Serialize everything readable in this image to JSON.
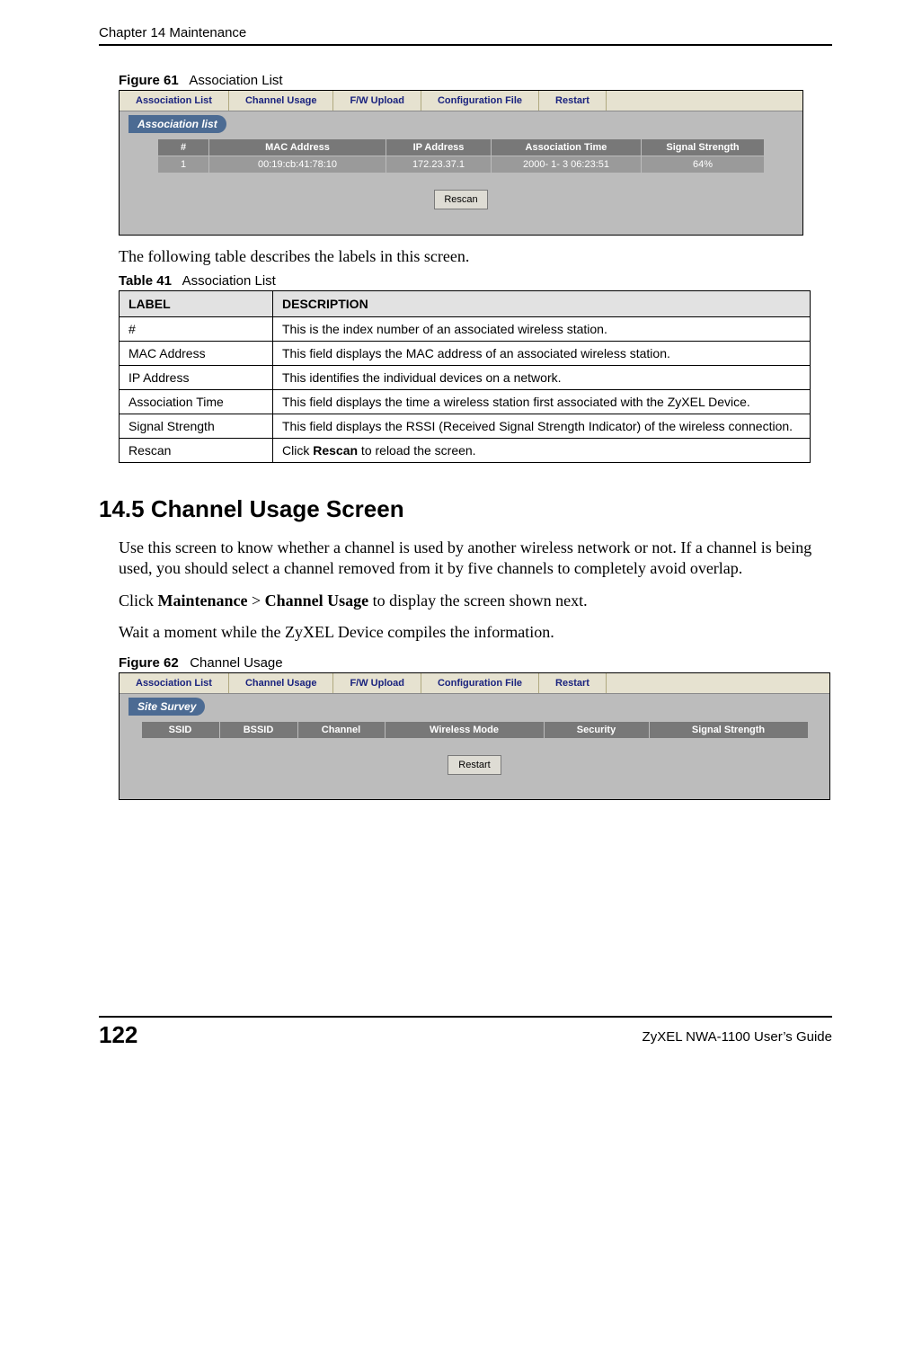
{
  "header": {
    "left": "Chapter 14 Maintenance"
  },
  "figure61": {
    "caption_bold": "Figure 61",
    "caption_rest": "Association List",
    "tabs": [
      "Association List",
      "Channel Usage",
      "F/W Upload",
      "Configuration File",
      "Restart"
    ],
    "bar": "Association list",
    "headers": [
      "#",
      "MAC Address",
      "IP Address",
      "Association Time",
      "Signal Strength"
    ],
    "row": [
      "1",
      "00:19:cb:41:78:10",
      "172.23.37.1",
      "2000- 1- 3 06:23:51",
      "64%"
    ],
    "button": "Rescan"
  },
  "intro_line": "The following table describes the labels in this screen.",
  "table41": {
    "caption_bold": "Table 41",
    "caption_rest": "Association List",
    "headers": [
      "LABEL",
      "DESCRIPTION"
    ],
    "rows": [
      {
        "label": "#",
        "desc": "This is the index number of an associated wireless station."
      },
      {
        "label": "MAC Address",
        "desc": "This field displays the MAC address of an associated wireless station."
      },
      {
        "label": "IP Address",
        "desc": "This identifies the individual devices on a network."
      },
      {
        "label": "Association Time",
        "desc": "This field displays the time a wireless station first associated with the ZyXEL Device."
      },
      {
        "label": "Signal Strength",
        "desc": "This field displays the RSSI (Received Signal Strength Indicator) of the wireless connection."
      },
      {
        "label": "Rescan",
        "desc_prefix": "Click ",
        "desc_bold": "Rescan",
        "desc_suffix": " to reload the screen."
      }
    ]
  },
  "section": {
    "heading": "14.5  Channel Usage Screen",
    "p1": "Use this screen to know whether a channel is used by another wireless network or not. If a channel is being used, you should select a channel removed from it by five channels to completely avoid overlap.",
    "p2_prefix": "Click ",
    "p2_b1": "Maintenance",
    "p2_mid": " > ",
    "p2_b2": "Channel Usage",
    "p2_suffix": " to display the screen shown next.",
    "p3": "Wait a moment while the ZyXEL Device compiles the information."
  },
  "figure62": {
    "caption_bold": "Figure 62",
    "caption_rest": "Channel Usage",
    "tabs": [
      "Association List",
      "Channel Usage",
      "F/W Upload",
      "Configuration File",
      "Restart"
    ],
    "bar": "Site Survey",
    "headers": [
      "SSID",
      "BSSID",
      "Channel",
      "Wireless Mode",
      "Security",
      "Signal Strength"
    ],
    "button": "Restart"
  },
  "footer": {
    "page": "122",
    "guide": "ZyXEL NWA-1100 User’s Guide"
  }
}
